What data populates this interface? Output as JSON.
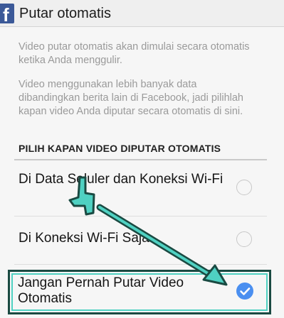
{
  "header": {
    "logo_letter": "f",
    "title": "Putar otomatis"
  },
  "description": {
    "paragraph_1": "Video putar otomatis akan dimulai secara otomatis ketika Anda menggulir.",
    "paragraph_2": "Video menggunakan lebih banyak data dibandingkan berita lain di Facebook, jadi pilihlah kapan video Anda diputar secara otomatis di sini."
  },
  "section": {
    "title": "PILIH KAPAN VIDEO DIPUTAR OTOMATIS"
  },
  "options": [
    {
      "label": "Di Data Seluler dan Koneksi Wi-Fi",
      "selected": false
    },
    {
      "label": "Di Koneksi Wi-Fi Saja",
      "selected": false
    },
    {
      "label": "Jangan Pernah Putar Video Otomatis",
      "selected": true
    }
  ],
  "colors": {
    "facebook_blue": "#3b5998",
    "radio_checked": "#4a8ff0",
    "annotation_fill": "#4fd1c2",
    "annotation_outline": "#1a4a42"
  },
  "icons": {
    "logo": "facebook-logo-icon",
    "unchecked": "radio-unchecked-icon",
    "checked": "radio-checked-icon",
    "pointer": "hand-pointer-icon",
    "arrow": "annotation-arrow-icon"
  }
}
